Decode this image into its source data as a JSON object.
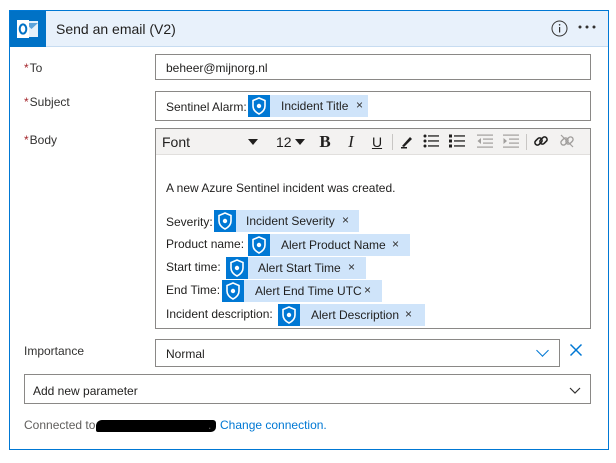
{
  "header": {
    "title": "Send an email (V2)",
    "icon": "outlook-icon",
    "info_icon": "info-icon",
    "more_icon": "more-options-icon"
  },
  "fields": {
    "to": {
      "required": "*",
      "label": "To",
      "value": "beheer@mijnorg.nl"
    },
    "subject": {
      "required": "*",
      "label": "Subject",
      "prefix": "Sentinel Alarm:",
      "token": "Incident Title"
    },
    "body": {
      "required": "*",
      "label": "Body"
    }
  },
  "toolbar": {
    "font": "Font",
    "size": "12",
    "bold": "B",
    "italic": "I",
    "underline": "U"
  },
  "body_content": {
    "intro": "A new Azure Sentinel incident was created.",
    "lines": [
      {
        "label": "Severity:",
        "token": "Incident Severity"
      },
      {
        "label": "Product name:",
        "token": "Alert Product Name"
      },
      {
        "label": "Start time:",
        "token": "Alert Start Time"
      },
      {
        "label": "End Time:",
        "token": "Alert End Time UTC"
      },
      {
        "label": "Incident description:",
        "token": "Alert Description"
      }
    ]
  },
  "importance": {
    "label": "Importance",
    "value": "Normal",
    "remove_icon": "close-icon"
  },
  "add_parameter": {
    "label": "Add new parameter"
  },
  "footer": {
    "connected_label": "Connected to",
    "suffix": ".",
    "change_link": "Change connection."
  },
  "token_close": "×",
  "colors": {
    "accent": "#0078d4",
    "token_bg": "#cfe4fa",
    "required": "#a4262c"
  }
}
